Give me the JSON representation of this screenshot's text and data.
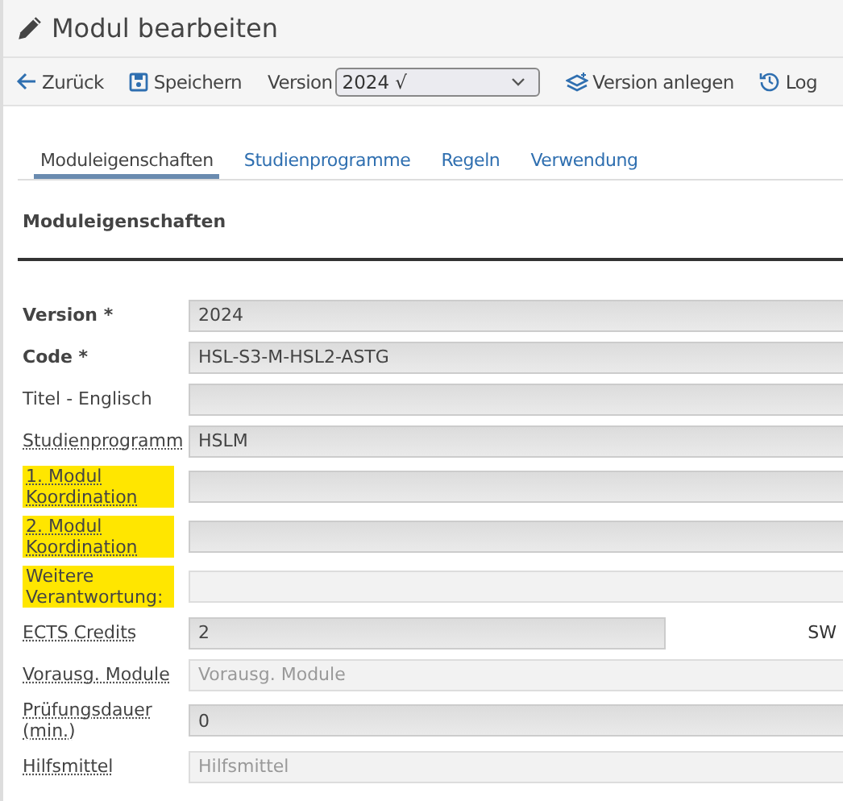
{
  "title": "Modul bearbeiten",
  "toolbar": {
    "back": "Zurück",
    "save": "Speichern",
    "version_label": "Version",
    "version_value": "2024 √",
    "new_version": "Version anlegen",
    "log": "Log"
  },
  "tabs": [
    {
      "label": "Moduleigenschaften",
      "selected": true
    },
    {
      "label": "Studienprogramme",
      "selected": false
    },
    {
      "label": "Regeln",
      "selected": false
    },
    {
      "label": "Verwendung",
      "selected": false
    }
  ],
  "section_title": "Moduleigenschaften",
  "fields": [
    {
      "label": "Version *",
      "bold": true,
      "hint": false,
      "highlighted": false,
      "kind": "filled",
      "value": "2024"
    },
    {
      "label": "Code *",
      "bold": true,
      "hint": false,
      "highlighted": false,
      "kind": "filled",
      "value": "HSL-S3-M-HSL2-ASTG"
    },
    {
      "label": "Titel - Englisch",
      "bold": false,
      "hint": false,
      "highlighted": false,
      "kind": "filled"
    },
    {
      "label": "Studienprogramm",
      "bold": false,
      "hint": true,
      "highlighted": false,
      "kind": "filled",
      "value": "HSLM"
    },
    {
      "label": "1. Modul Koordination",
      "bold": false,
      "hint": true,
      "highlighted": true,
      "kind": "filled"
    },
    {
      "label": "2. Modul Koordination",
      "bold": false,
      "hint": true,
      "highlighted": true,
      "kind": "filled"
    },
    {
      "label": "Weitere Verantwortung:",
      "bold": false,
      "hint": false,
      "highlighted": true,
      "kind": "plain"
    },
    {
      "label": "ECTS Credits",
      "bold": false,
      "hint": true,
      "highlighted": false,
      "kind": "short",
      "value": "2",
      "side_label": "SW"
    },
    {
      "label": "Vorausg. Module",
      "bold": false,
      "hint": true,
      "highlighted": false,
      "kind": "plain",
      "placeholder": "Vorausg. Module"
    },
    {
      "label": "Prüfungsdauer (min.)",
      "bold": false,
      "hint": true,
      "highlighted": false,
      "kind": "filled",
      "value": "0"
    },
    {
      "label": "Hilfsmittel",
      "bold": false,
      "hint": true,
      "highlighted": false,
      "kind": "plain",
      "placeholder": "Hilfsmittel"
    }
  ]
}
